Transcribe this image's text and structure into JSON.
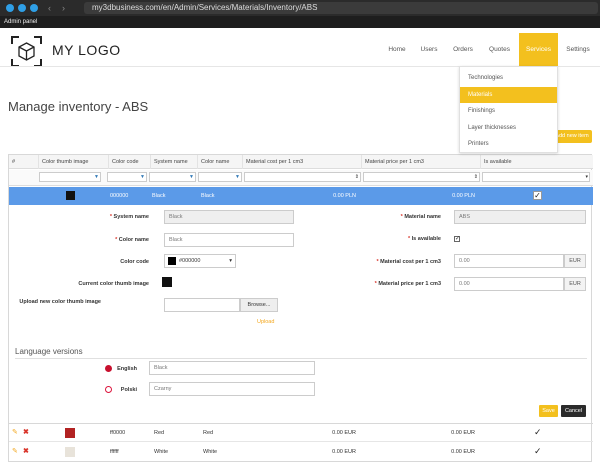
{
  "browser": {
    "url": "my3dbusiness.com/en/Admin/Services/Materials/Inventory/ABS",
    "admin_panel_label": "Admin panel"
  },
  "header": {
    "logo_text": "MY LOGO",
    "nav": [
      "Home",
      "Users",
      "Orders",
      "Quotes",
      "Services",
      "Settings"
    ],
    "active_nav": "Services"
  },
  "services_menu": {
    "items": [
      "Technologies",
      "Materials",
      "Finishings",
      "Layer thicknesses",
      "Printers"
    ],
    "active": "Materials"
  },
  "page": {
    "title": "Manage inventory - ABS",
    "add_button": "Add new item"
  },
  "table": {
    "columns": [
      "#",
      "Color thumb image",
      "Color code",
      "System name",
      "Color name",
      "Material cost per 1 cm3",
      "Material price per 1 cm3",
      "Is available"
    ],
    "selected_row": {
      "color_code": "000000",
      "system_name": "Black",
      "color_name": "Black",
      "cost": "0.00 PLN",
      "price": "0.00 PLN",
      "swatch_color": "#111111",
      "available_mark": "✓"
    },
    "rows": [
      {
        "color_code": "ff0000",
        "system_name": "Red",
        "color_name": "Red",
        "cost": "0.00 EUR",
        "price": "0.00 EUR",
        "swatch_color": "#b22222",
        "available_mark": "✓"
      },
      {
        "color_code": "ffffff",
        "system_name": "White",
        "color_name": "White",
        "cost": "0.00 EUR",
        "price": "0.00 EUR",
        "swatch_color": "#e8e3da",
        "available_mark": "✓"
      }
    ]
  },
  "form": {
    "system_name_label": "System name",
    "system_name_value": "Black",
    "color_name_label": "Color name",
    "color_name_value": "Black",
    "color_code_label": "Color code",
    "color_code_value": "#000000",
    "current_thumb_label": "Current color thumb image",
    "upload_label": "Upload new color thumb image",
    "browse_label": "Browse...",
    "upload_link": "Upload",
    "material_name_label": "Material name",
    "material_name_value": "ABS",
    "is_available_label": "Is available",
    "is_available_mark": "✓",
    "cost_label": "Material cost per 1 cm3",
    "cost_value": "0.00",
    "cost_currency": "EUR",
    "price_label": "Material price per 1 cm3",
    "price_value": "0.00",
    "price_currency": "EUR",
    "required_mark": "*"
  },
  "languages": {
    "title": "Language versions",
    "items": [
      {
        "label": "English",
        "value": "Black",
        "flag_color": "#c8102e"
      },
      {
        "label": "Polski",
        "value": "Czarny",
        "flag_color": "#dc143c"
      }
    ]
  },
  "actions": {
    "save": "Save",
    "cancel": "Cancel"
  },
  "colors": {
    "accent": "#f3c01e",
    "selected_row": "#5b9ae8",
    "link": "#337ab7"
  }
}
